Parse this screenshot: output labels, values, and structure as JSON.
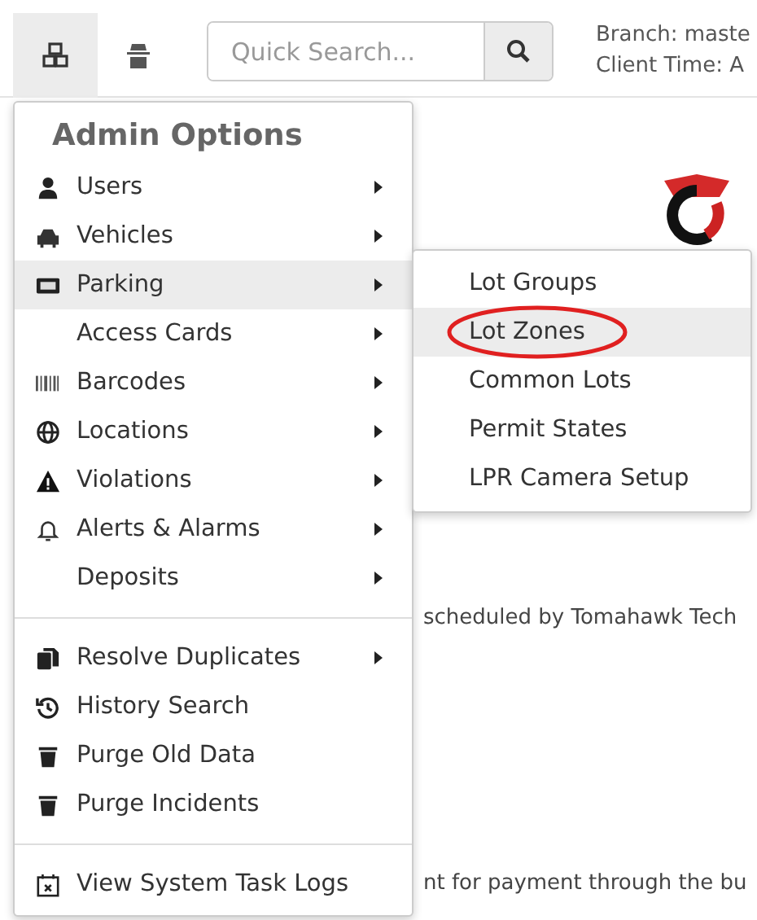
{
  "toolbar": {
    "search": {
      "placeholder": "Quick Search..."
    },
    "branch": "Branch: maste",
    "client_time": "Client Time: A"
  },
  "background_texts": [
    "scheduled by Tomahawk Tech",
    "nt for payment through the bu"
  ],
  "menu": {
    "title": "Admin Options",
    "sections": [
      [
        {
          "label": "Users",
          "has_submenu": true,
          "selected": false
        },
        {
          "label": "Vehicles",
          "has_submenu": true,
          "selected": false
        },
        {
          "label": "Parking",
          "has_submenu": true,
          "selected": true
        },
        {
          "label": "Access Cards",
          "has_submenu": true,
          "selected": false
        },
        {
          "label": "Barcodes",
          "has_submenu": true,
          "selected": false
        },
        {
          "label": "Locations",
          "has_submenu": true,
          "selected": false
        },
        {
          "label": "Violations",
          "has_submenu": true,
          "selected": false
        },
        {
          "label": "Alerts & Alarms",
          "has_submenu": true,
          "selected": false
        },
        {
          "label": "Deposits",
          "has_submenu": true,
          "selected": false
        }
      ],
      [
        {
          "label": "Resolve Duplicates",
          "has_submenu": true,
          "selected": false
        },
        {
          "label": "History Search",
          "has_submenu": false,
          "selected": false
        },
        {
          "label": "Purge Old Data",
          "has_submenu": false,
          "selected": false
        },
        {
          "label": "Purge Incidents",
          "has_submenu": false,
          "selected": false
        }
      ],
      [
        {
          "label": "View System Task Logs",
          "has_submenu": false,
          "selected": false
        }
      ]
    ]
  },
  "submenu": {
    "items": [
      {
        "label": "Lot Groups",
        "selected": false,
        "circled": false
      },
      {
        "label": "Lot Zones",
        "selected": true,
        "circled": true
      },
      {
        "label": "Common Lots",
        "selected": false,
        "circled": false
      },
      {
        "label": "Permit States",
        "selected": false,
        "circled": false
      },
      {
        "label": "LPR Camera Setup",
        "selected": false,
        "circled": false
      }
    ]
  }
}
